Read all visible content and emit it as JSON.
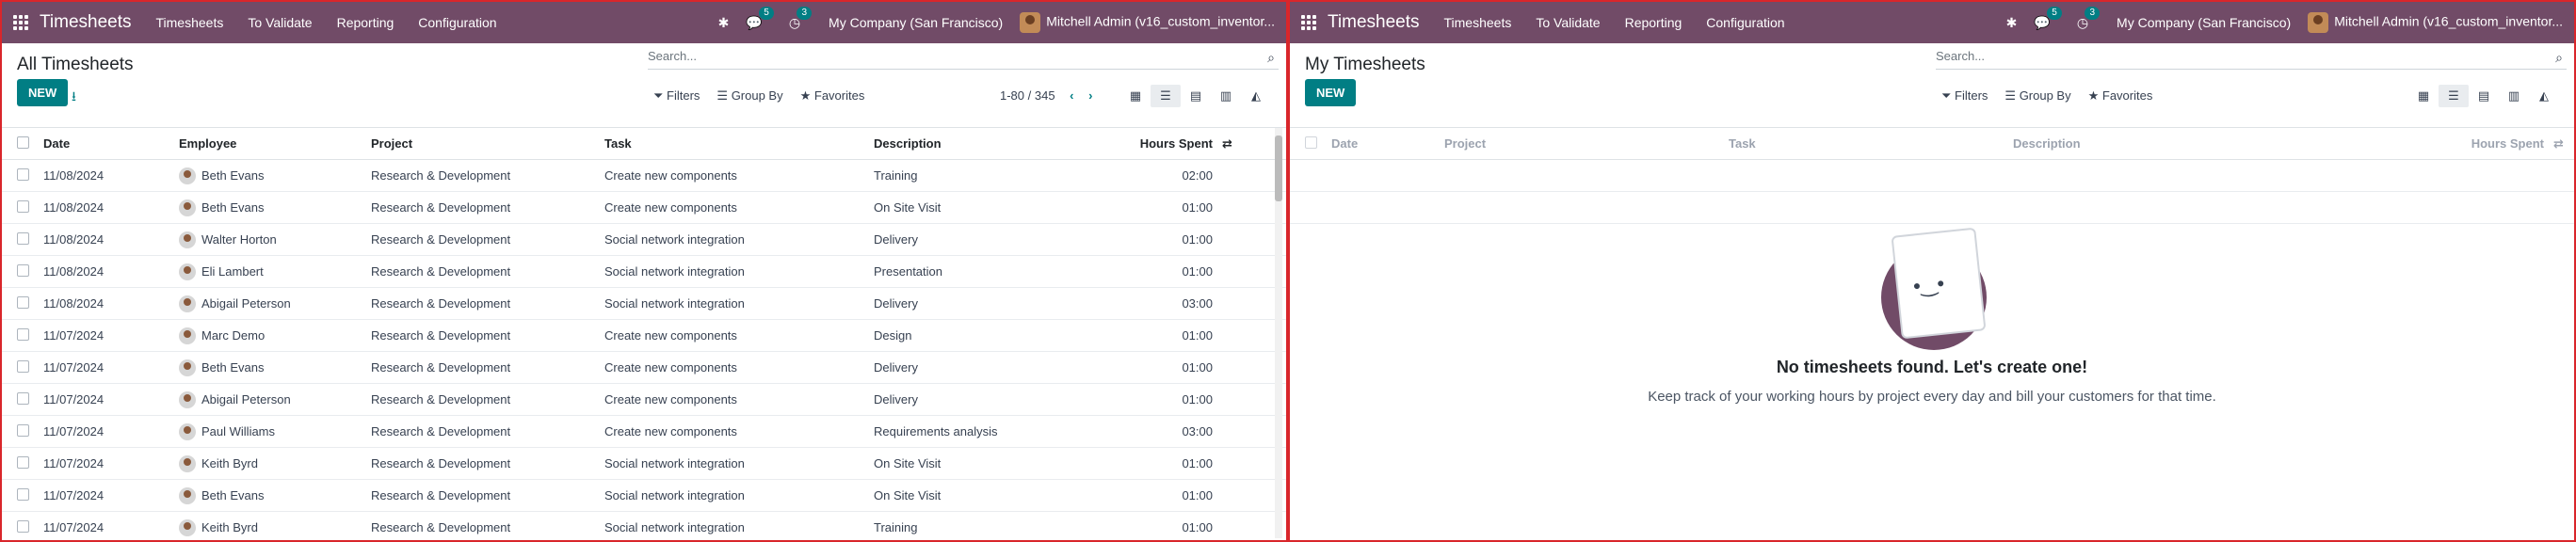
{
  "left": {
    "navbar": {
      "brand": "Timesheets",
      "menus": [
        "Timesheets",
        "To Validate",
        "Reporting",
        "Configuration"
      ],
      "chat_count": "5",
      "activity_count": "3",
      "company": "My Company (San Francisco)",
      "user": "Mitchell Admin (v16_custom_inventor..."
    },
    "title": "All Timesheets",
    "new_label": "NEW",
    "search_placeholder": "Search...",
    "filters_label": "Filters",
    "groupby_label": "Group By",
    "favorites_label": "Favorites",
    "pager": "1-80 / 345",
    "columns": {
      "date": "Date",
      "employee": "Employee",
      "project": "Project",
      "task": "Task",
      "description": "Description",
      "hours": "Hours Spent"
    },
    "rows": [
      {
        "date": "11/08/2024",
        "employee": "Beth Evans",
        "project": "Research & Development",
        "task": "Create new components",
        "description": "Training",
        "hours": "02:00"
      },
      {
        "date": "11/08/2024",
        "employee": "Beth Evans",
        "project": "Research & Development",
        "task": "Create new components",
        "description": "On Site Visit",
        "hours": "01:00"
      },
      {
        "date": "11/08/2024",
        "employee": "Walter Horton",
        "project": "Research & Development",
        "task": "Social network integration",
        "description": "Delivery",
        "hours": "01:00"
      },
      {
        "date": "11/08/2024",
        "employee": "Eli Lambert",
        "project": "Research & Development",
        "task": "Social network integration",
        "description": "Presentation",
        "hours": "01:00"
      },
      {
        "date": "11/08/2024",
        "employee": "Abigail Peterson",
        "project": "Research & Development",
        "task": "Social network integration",
        "description": "Delivery",
        "hours": "03:00"
      },
      {
        "date": "11/07/2024",
        "employee": "Marc Demo",
        "project": "Research & Development",
        "task": "Create new components",
        "description": "Design",
        "hours": "01:00"
      },
      {
        "date": "11/07/2024",
        "employee": "Beth Evans",
        "project": "Research & Development",
        "task": "Create new components",
        "description": "Delivery",
        "hours": "01:00"
      },
      {
        "date": "11/07/2024",
        "employee": "Abigail Peterson",
        "project": "Research & Development",
        "task": "Create new components",
        "description": "Delivery",
        "hours": "01:00"
      },
      {
        "date": "11/07/2024",
        "employee": "Paul Williams",
        "project": "Research & Development",
        "task": "Create new components",
        "description": "Requirements analysis",
        "hours": "03:00"
      },
      {
        "date": "11/07/2024",
        "employee": "Keith Byrd",
        "project": "Research & Development",
        "task": "Social network integration",
        "description": "On Site Visit",
        "hours": "01:00"
      },
      {
        "date": "11/07/2024",
        "employee": "Beth Evans",
        "project": "Research & Development",
        "task": "Social network integration",
        "description": "On Site Visit",
        "hours": "01:00"
      },
      {
        "date": "11/07/2024",
        "employee": "Keith Byrd",
        "project": "Research & Development",
        "task": "Social network integration",
        "description": "Training",
        "hours": "01:00"
      }
    ]
  },
  "right": {
    "navbar": {
      "brand": "Timesheets",
      "menus": [
        "Timesheets",
        "To Validate",
        "Reporting",
        "Configuration"
      ],
      "chat_count": "5",
      "activity_count": "3",
      "company": "My Company (San Francisco)",
      "user": "Mitchell Admin (v16_custom_inventor..."
    },
    "title": "My Timesheets",
    "new_label": "NEW",
    "search_placeholder": "Search...",
    "filters_label": "Filters",
    "groupby_label": "Group By",
    "favorites_label": "Favorites",
    "columns": {
      "date": "Date",
      "project": "Project",
      "task": "Task",
      "description": "Description",
      "hours": "Hours Spent"
    },
    "empty_title": "No timesheets found. Let's create one!",
    "empty_text": "Keep track of your working hours by project every day and bill your customers for that time."
  },
  "colors": {
    "navbar": "#714b67",
    "primary": "#017e84",
    "frame": "#d9262b"
  }
}
